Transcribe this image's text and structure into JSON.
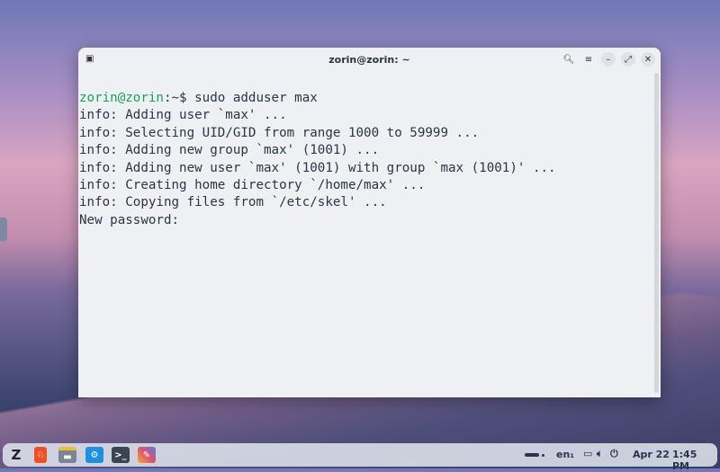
{
  "window": {
    "title": "zorin@zorin: ~"
  },
  "terminal": {
    "prompt_user": "zorin@zorin",
    "prompt_path": ":~$",
    "command": " sudo adduser max",
    "lines": [
      "info: Adding user `max' ...",
      "info: Selecting UID/GID from range 1000 to 59999 ...",
      "info: Adding new group `max' (1001) ...",
      "info: Adding new user `max' (1001) with group `max (1001)' ...",
      "info: Creating home directory `/home/max' ...",
      "info: Copying files from `/etc/skel' ...",
      "New password:"
    ]
  },
  "taskbar": {
    "apps": [
      "zorin-menu",
      "brave-browser",
      "files",
      "software-store",
      "terminal",
      "paint"
    ],
    "language": "en₁",
    "date": "Apr 22",
    "time": "1:45 PM"
  }
}
